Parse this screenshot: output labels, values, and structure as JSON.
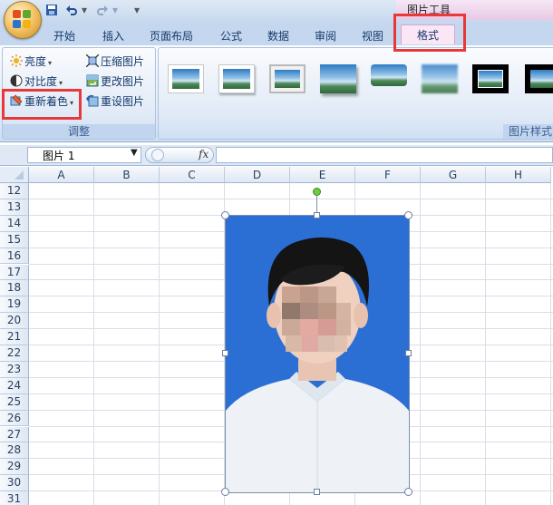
{
  "titlebar": {
    "context_title": "图片工具"
  },
  "tabs": [
    "开始",
    "插入",
    "页面布局",
    "公式",
    "数据",
    "审阅",
    "视图"
  ],
  "active_tab": "格式",
  "ribbon": {
    "adjust": {
      "brightness": "亮度",
      "contrast": "对比度",
      "recolor": "重新着色",
      "compress": "压缩图片",
      "change": "更改图片",
      "reset": "重设图片",
      "group_label": "调整"
    },
    "styles": {
      "group_label": "图片样式"
    }
  },
  "formula_bar": {
    "name_box": "图片 1",
    "fx": "fx"
  },
  "columns": [
    "A",
    "B",
    "C",
    "D",
    "E",
    "F",
    "G",
    "H"
  ],
  "rows": [
    "12",
    "13",
    "14",
    "15",
    "16",
    "17",
    "18",
    "19",
    "20",
    "21",
    "22",
    "23",
    "24",
    "25",
    "26",
    "27",
    "28",
    "29",
    "30",
    "31"
  ],
  "colors": {
    "highlight": "#e8383a",
    "photo_bg": "#2c6fd4",
    "context_tab": "#fbe6f6"
  }
}
